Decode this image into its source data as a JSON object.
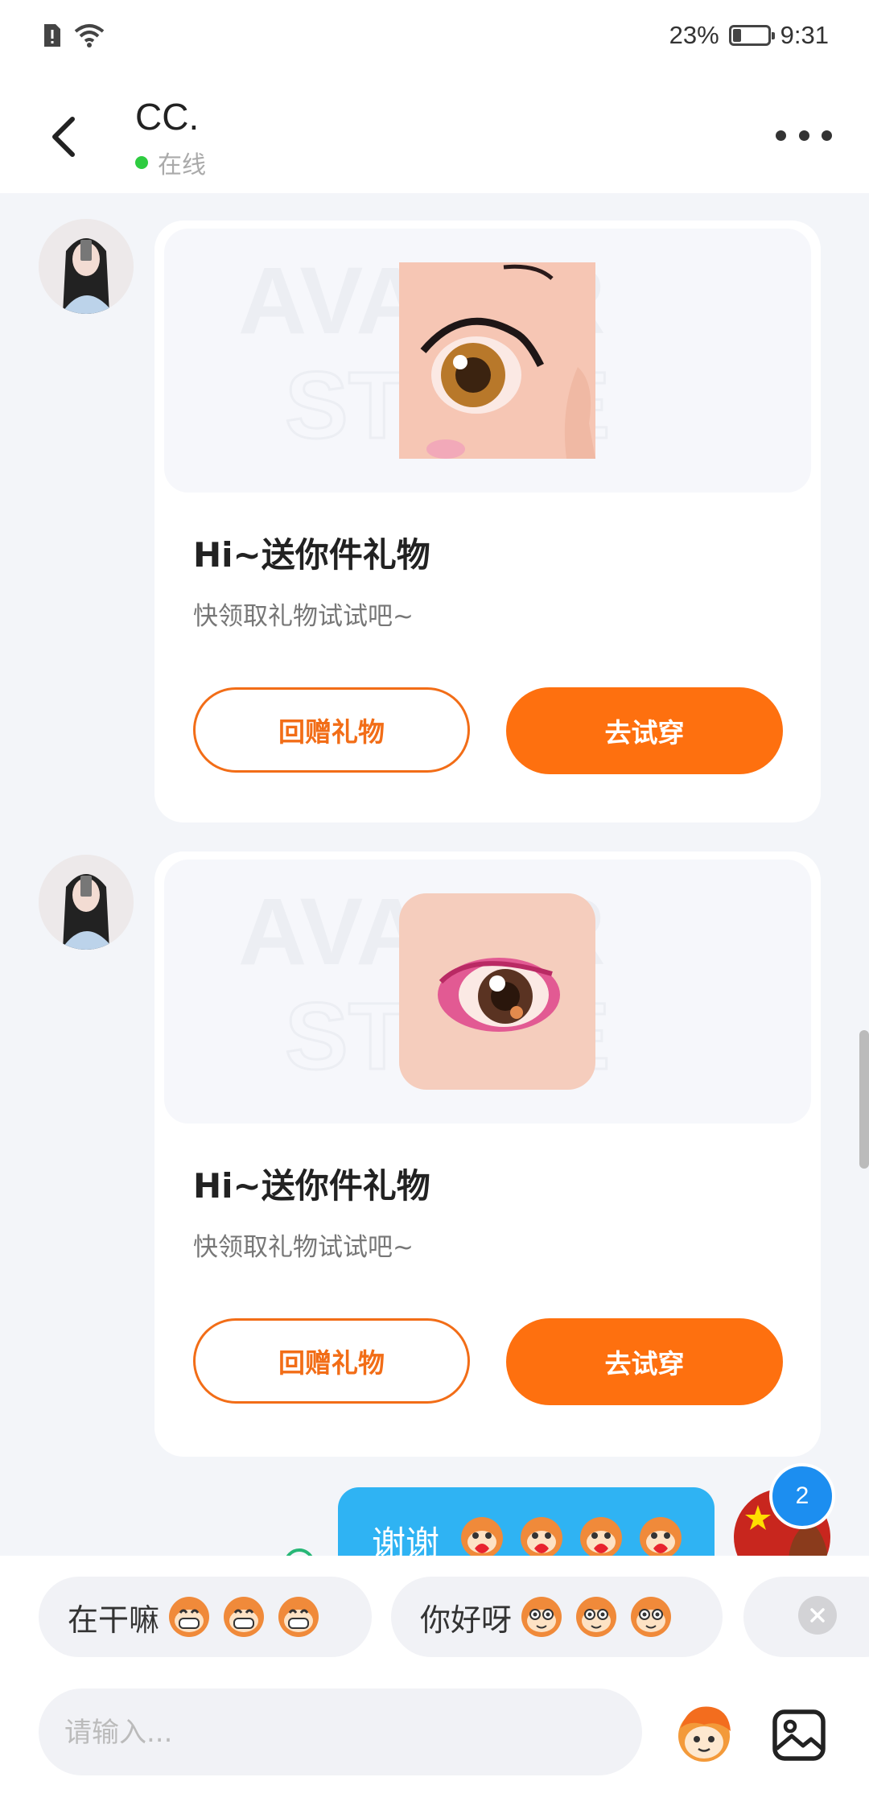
{
  "status_bar": {
    "battery": "23%",
    "time": "9:31",
    "battery_level": 0.23
  },
  "header": {
    "name": "CC.",
    "status": "在线"
  },
  "messages": [
    {
      "title": "Hi~送你件礼物",
      "subtitle": "快领取礼物试试吧~",
      "btn_return": "回赠礼物",
      "btn_try": "去试穿",
      "watermark": "AVATAR STORE",
      "gift": "eye-1"
    },
    {
      "title": "Hi~送你件礼物",
      "subtitle": "快领取礼物试试吧~",
      "btn_return": "回赠礼物",
      "btn_try": "去试穿",
      "watermark": "AVATAR STORE",
      "gift": "eye-2"
    }
  ],
  "my_message": {
    "text": "谢谢",
    "badge": "2"
  },
  "quick_replies": [
    {
      "text": "在干嘛"
    },
    {
      "text": "你好呀"
    }
  ],
  "input": {
    "placeholder": "请输入..."
  },
  "colors": {
    "accent": "#fe700f",
    "bubble": "#2fb3f3",
    "online": "#2ecc40",
    "badge": "#1c8ef0"
  }
}
